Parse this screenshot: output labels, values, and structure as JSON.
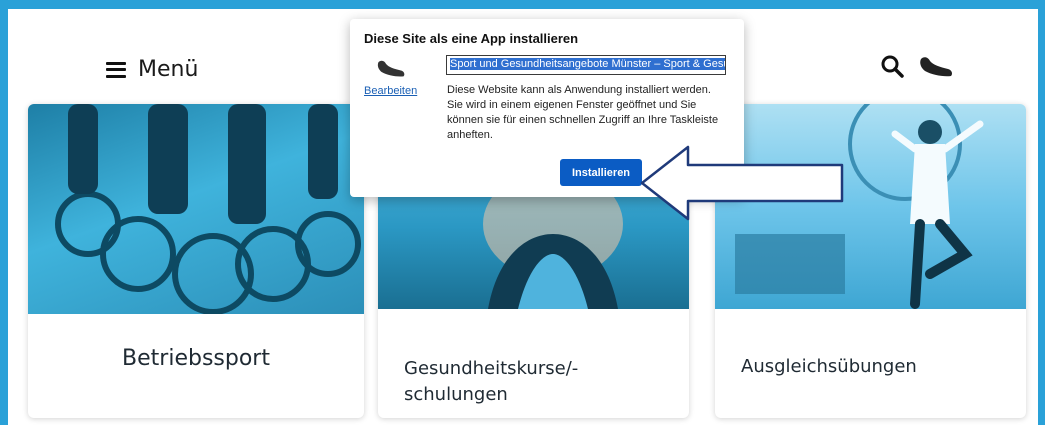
{
  "header": {
    "menu_label": "Menü",
    "icons": [
      "search-icon",
      "shoe-icon"
    ]
  },
  "cards": [
    {
      "title": "Betriebssport",
      "image": "cyclists-photo"
    },
    {
      "title_line1": "Gesundheitskurse/-",
      "title_line2": "schulungen",
      "image": "fitness-woman-photo"
    },
    {
      "title": "Ausgleichsübungen",
      "image": "office-yoga-photo"
    }
  ],
  "install_dialog": {
    "title": "Diese Site als eine App installieren",
    "edit_link": "Bearbeiten",
    "app_name_value": "Sport und Gesundheitsangebote Münster – Sport & Gesu",
    "description": "Diese Website kann als Anwendung installiert werden. Sie wird in einem eigenen Fenster geöffnet und Sie können sie für einen schnellen Zugriff an Ihre Taskleiste anheften.",
    "install_button": "Installieren"
  },
  "colors": {
    "frame": "#2aa1d8",
    "button": "#0b5cc4",
    "arrow_stroke": "#1f3a7a"
  }
}
